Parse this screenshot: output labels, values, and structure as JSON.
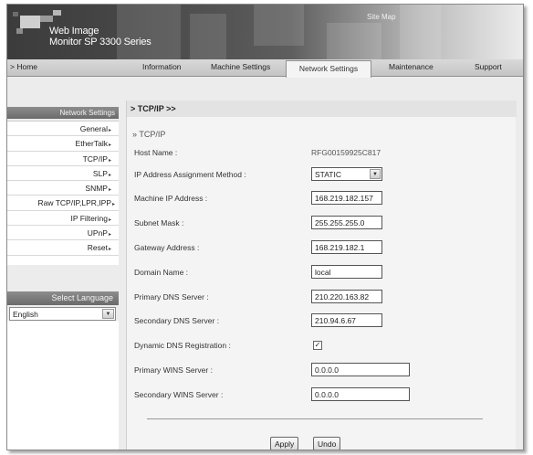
{
  "header": {
    "brand_line1": "Web Image",
    "brand_line2": "Monitor SP 3300 Series",
    "site_map": "Site Map"
  },
  "tabs": {
    "home": "> Home",
    "items": [
      {
        "label": "Information"
      },
      {
        "label": "Machine Settings"
      },
      {
        "label": "Network Settings"
      },
      {
        "label": "Maintenance"
      },
      {
        "label": "Support"
      }
    ],
    "active": "Network Settings"
  },
  "sidebar": {
    "section_title": "Network Settings",
    "items": [
      {
        "label": "General"
      },
      {
        "label": "EtherTalk"
      },
      {
        "label": "TCP/IP"
      },
      {
        "label": "SLP"
      },
      {
        "label": "SNMP"
      },
      {
        "label": "Raw TCP/IP,LPR,IPP"
      },
      {
        "label": "IP Filtering"
      },
      {
        "label": "UPnP"
      },
      {
        "label": "Reset"
      }
    ],
    "language_title": "Select Language",
    "language_value": "English"
  },
  "main": {
    "title": "> TCP/IP >>",
    "subhead": "» TCP/IP",
    "host_name_label": "Host Name :",
    "host_name_value": "RFG00159925C817",
    "ip_method_label": "IP Address Assignment Method :",
    "ip_method_value": "STATIC",
    "machine_ip_label": "Machine IP Address :",
    "machine_ip_value": "168.219.182.157",
    "subnet_label": "Subnet Mask :",
    "subnet_value": "255.255.255.0",
    "gateway_label": "Gateway Address :",
    "gateway_value": "168.219.182.1",
    "domain_label": "Domain Name :",
    "domain_value": "local",
    "primary_dns_label": "Primary DNS Server :",
    "primary_dns_value": "210.220.163.82",
    "secondary_dns_label": "Secondary DNS Server :",
    "secondary_dns_value": "210.94.6.67",
    "ddns_label": "Dynamic DNS Registration :",
    "ddns_checked": true,
    "primary_wins_label": "Primary WINS Server :",
    "primary_wins_value": "0.0.0.0",
    "secondary_wins_label": "Secondary WINS Server :",
    "secondary_wins_value": "0.0.0.0",
    "apply_label": "Apply",
    "undo_label": "Undo"
  }
}
